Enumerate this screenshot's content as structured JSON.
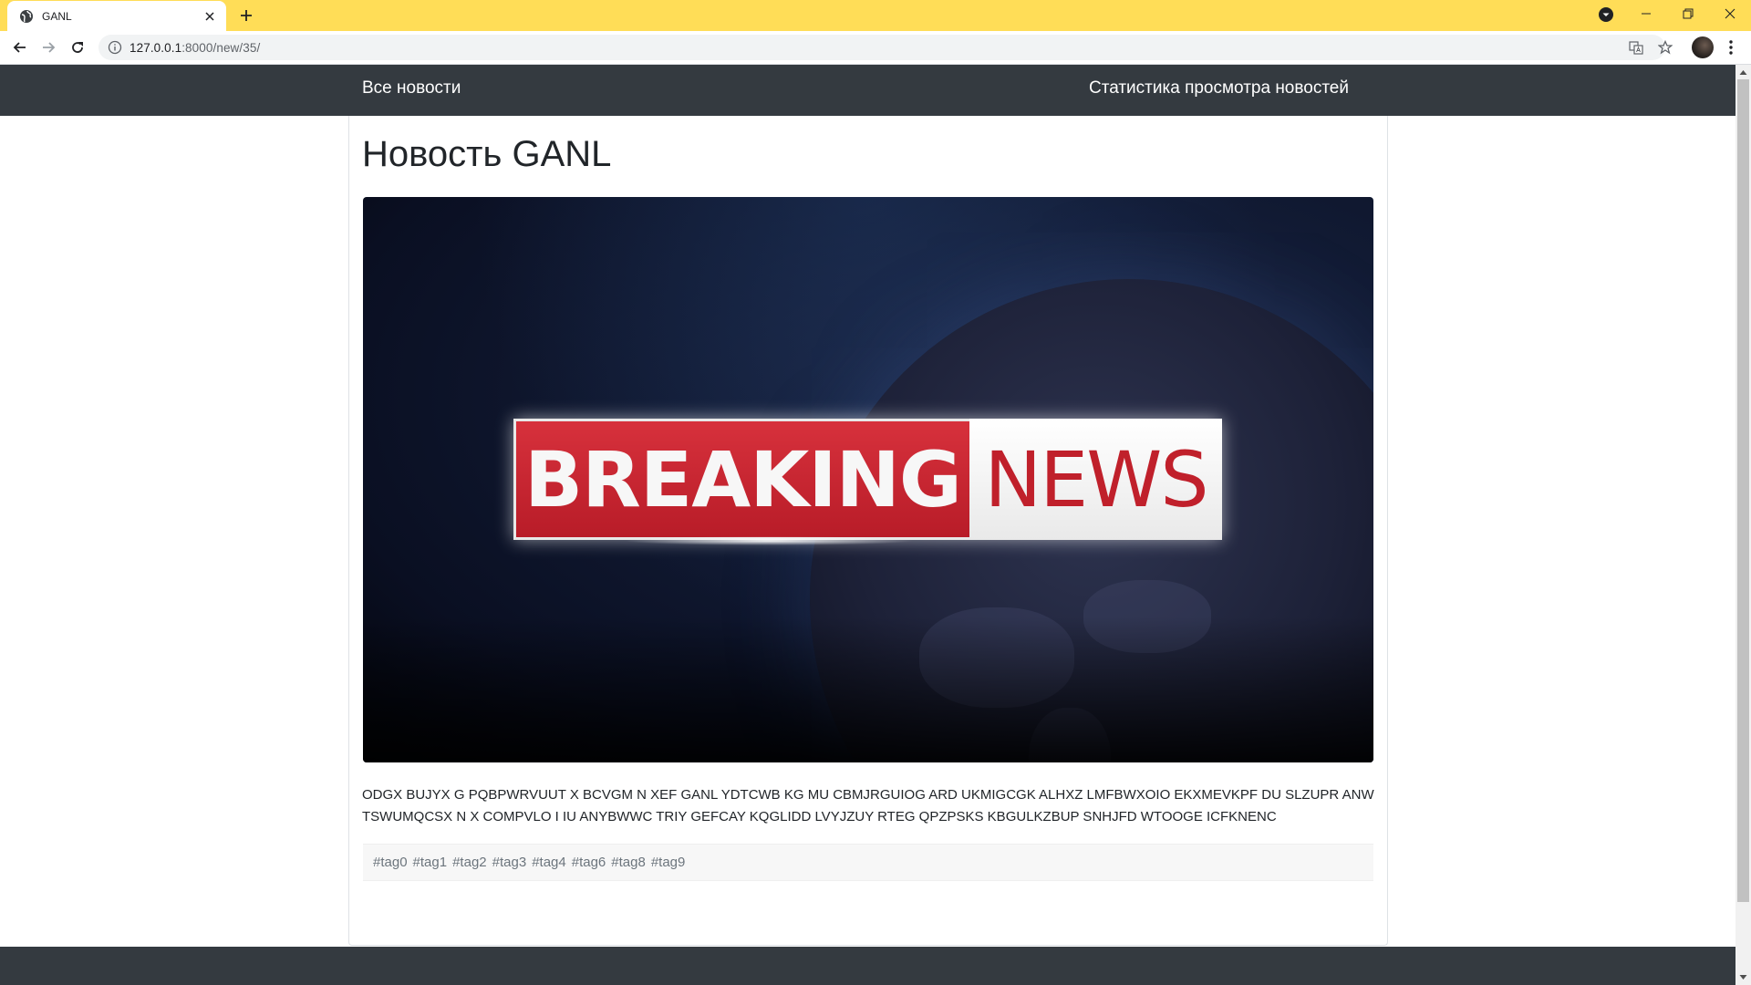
{
  "browser": {
    "tab_title": "GANL",
    "url_host": "127.0.0.1",
    "url_rest": ":8000/new/35/",
    "colors": {
      "titlebar": "#ffdd57"
    }
  },
  "site": {
    "nav": {
      "all_news": "Все новости",
      "stats": "Статистика просмотра новостей"
    },
    "news": {
      "title": "Новость GANL",
      "image_text_left": "BREAKING",
      "image_text_right": "NEWS",
      "body": "ODGX BUJYX G PQBPWRVUUT X BCVGM N XEF GANL YDTCWB KG MU CBMJRGUIOG ARD UKMIGCGK ALHXZ LMFBWXOIO EKXMEVKPF DU SLZUPR ANW TSWUMQCSX N X COMPVLO I IU ANYBWWC TRIY GEFCAY KQGLIDD LVYJZUY RTEG QPZPSKS KBGULKZBUP SNHJFD WTOOGE ICFKNENC",
      "tags": [
        "#tag0",
        "#tag1",
        "#tag2",
        "#tag3",
        "#tag4",
        "#tag6",
        "#tag8",
        "#tag9"
      ]
    },
    "colors": {
      "navbar": "#343a40",
      "banner_red": "#c8222d",
      "tag_text": "#6c757d"
    }
  }
}
